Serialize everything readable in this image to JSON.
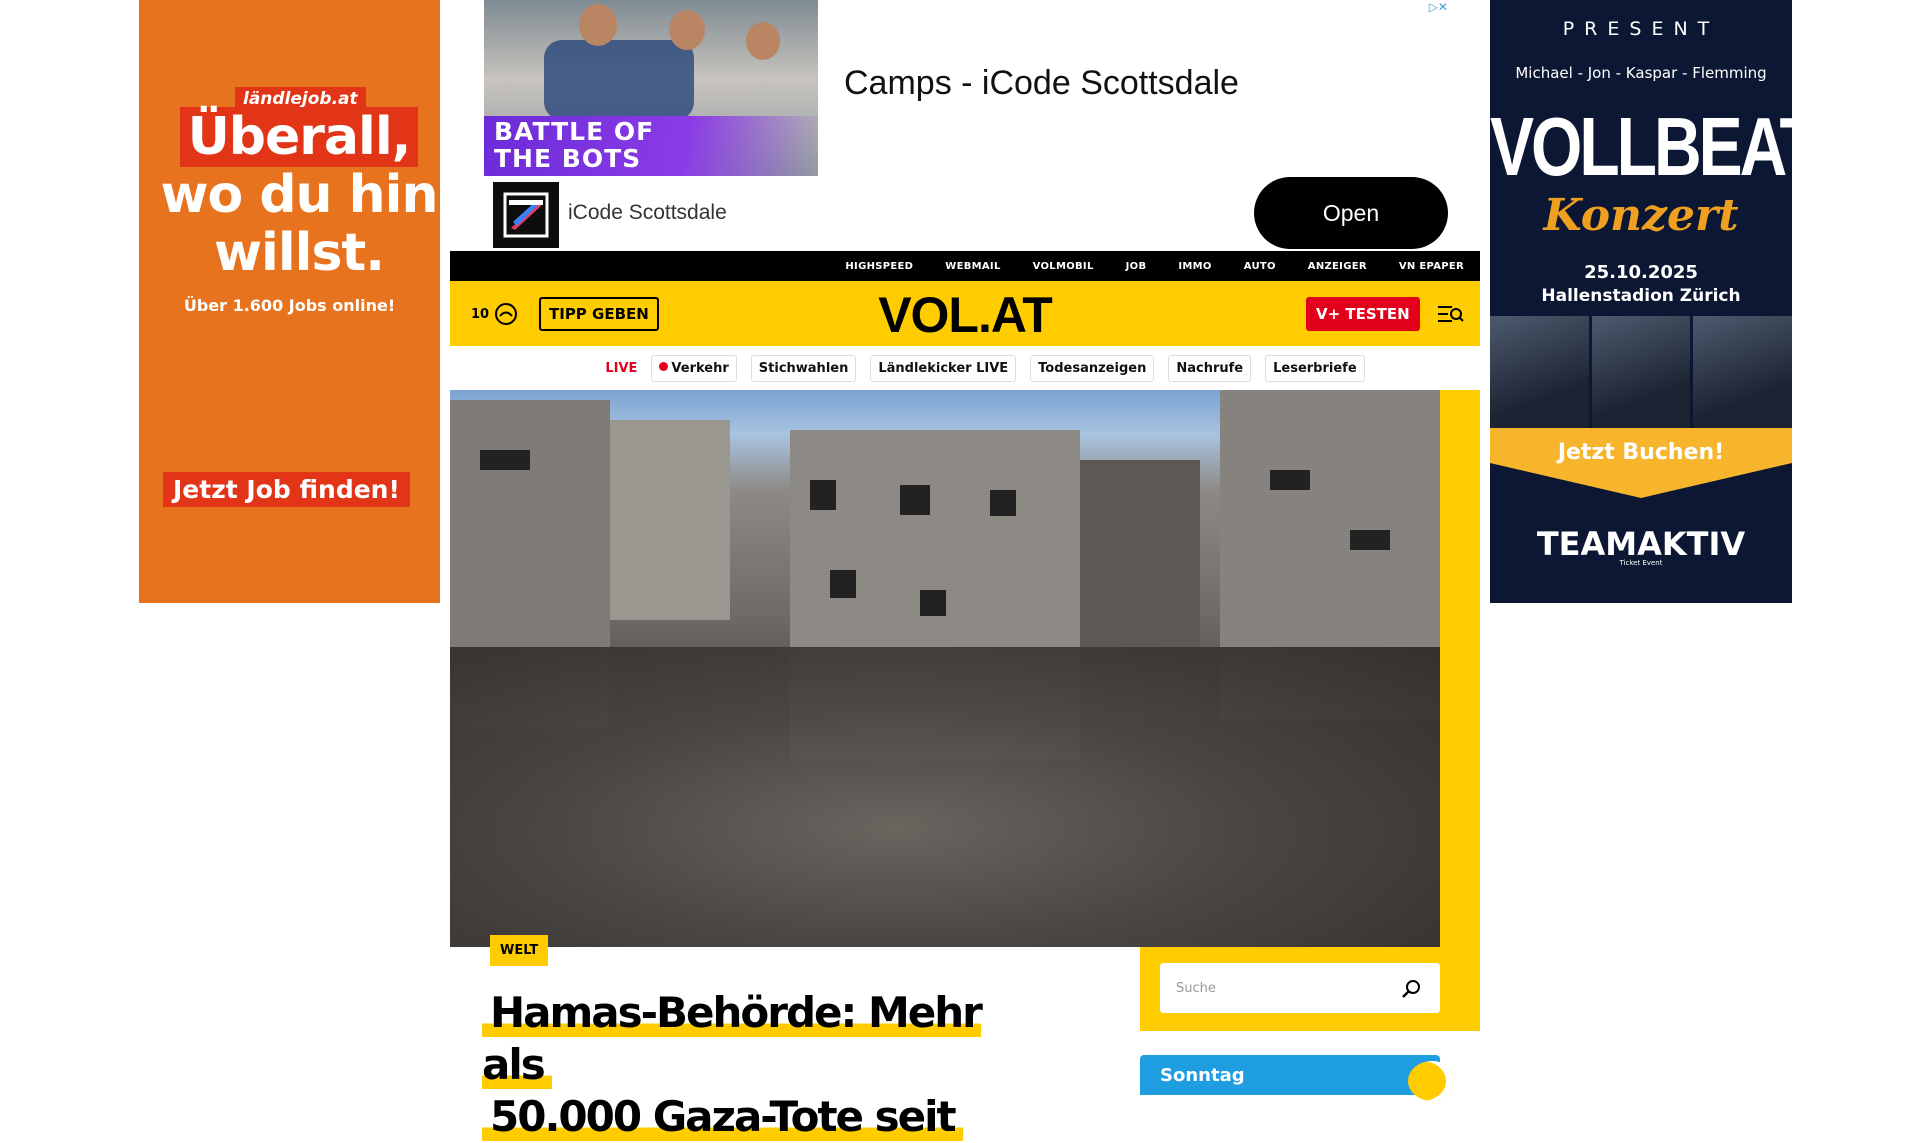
{
  "left_ad": {
    "brand": "ländlejob.at",
    "headline_line1": "Überall,",
    "headline_line2": "wo du hin",
    "headline_line3": "willst.",
    "subline": "Über 1.600 Jobs online!",
    "cta": "Jetzt Job finden!",
    "colors": {
      "background": "#e8731e",
      "accent": "#e23517"
    }
  },
  "top_ad": {
    "image_caption": "BATTLE OF THE BOTS",
    "headline": "Camps - iCode Scottsdale",
    "advertiser": "iCode Scottsdale",
    "open_label": "Open"
  },
  "right_ad": {
    "present": "PRESENT",
    "names": "Michael - Jon - Kaspar - Flemming",
    "band": "VOLLBEAT",
    "subtitle": "Konzert",
    "date": "25.10.2025",
    "venue": "Hallenstadion Zürich",
    "cta": "Jetzt Buchen!",
    "sponsor": "TEAMAKTIV",
    "sponsor_sub": "Ticket Event"
  },
  "topnav": {
    "items": [
      "HIGHSPEED",
      "WEBMAIL",
      "VOLMOBIL",
      "JOB",
      "IMMO",
      "AUTO",
      "ANZEIGER",
      "VN EPAPER"
    ]
  },
  "masthead": {
    "temperature": "10",
    "tipp_label": "TIPP GEBEN",
    "logo": "VOL.AT",
    "vplus_label": "V+ TESTEN",
    "colors": {
      "brand_yellow": "#ffcc00",
      "red": "#e2001a"
    }
  },
  "tagbar": {
    "live_label": "LIVE",
    "tags": [
      "Verkehr",
      "Stichwahlen",
      "Ländlekicker LIVE",
      "Todesanzeigen",
      "Nachrufe",
      "Leserbriefe"
    ]
  },
  "article": {
    "category": "WELT",
    "title_line1": "Hamas-Behörde: Mehr als",
    "title_line2": "50.000 Gaza-Tote seit"
  },
  "sidebar": {
    "search_placeholder": "Suche",
    "weather_label": "Sonntag"
  }
}
